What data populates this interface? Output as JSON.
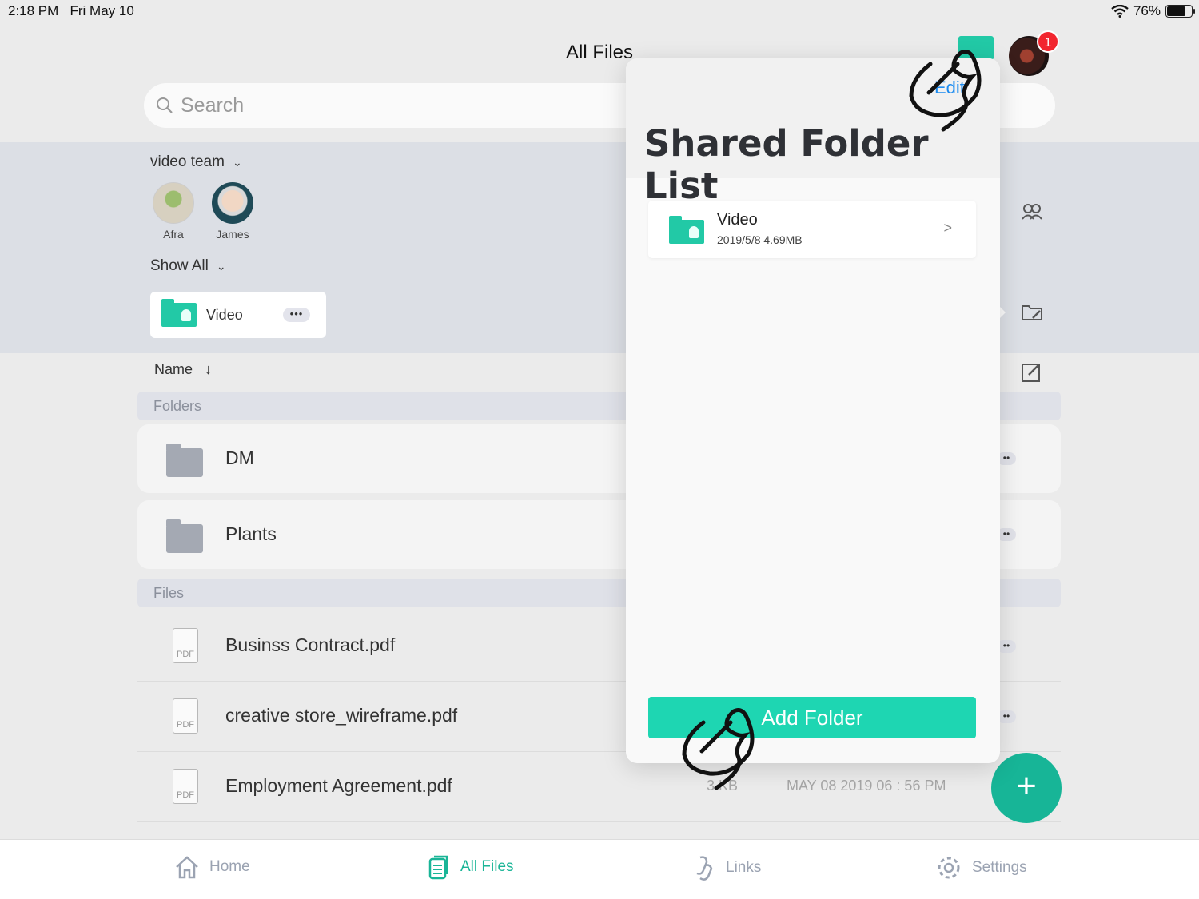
{
  "status_bar": {
    "time": "2:18 PM",
    "date": "Fri May 10",
    "battery": "76%",
    "battery_level": 0.76
  },
  "header": {
    "title": "All Files",
    "notification_count": "1"
  },
  "search": {
    "placeholder": "Search"
  },
  "team": {
    "name": "video team",
    "members": [
      {
        "name": "Afra"
      },
      {
        "name": "James"
      }
    ],
    "filter_label": "Show All",
    "shared_folder": {
      "name": "Video",
      "more": "•••"
    }
  },
  "list": {
    "sort_label": "Name",
    "folders_header": "Folders",
    "folders": [
      {
        "name": "DM"
      },
      {
        "name": "Plants"
      }
    ],
    "files_header": "Files",
    "files": [
      {
        "name": "Businss Contract.pdf",
        "icon": "PDF"
      },
      {
        "name": "creative store_wireframe.pdf",
        "icon": "PDF"
      },
      {
        "name": "Employment Agreement.pdf",
        "icon": "PDF",
        "size": "3 KB",
        "date": "MAY 08 2019 06 : 56 PM"
      }
    ]
  },
  "popover": {
    "edit_label": "Edit",
    "title": "Shared Folder List",
    "items": [
      {
        "name": "Video",
        "meta": "2019/5/8  4.69MB",
        "chevron": ">"
      }
    ],
    "add_button": "Add Folder"
  },
  "tabbar": {
    "tabs": [
      {
        "label": "Home"
      },
      {
        "label": "All Files"
      },
      {
        "label": "Links"
      },
      {
        "label": "Settings"
      }
    ]
  },
  "colors": {
    "accent": "#1ab597",
    "button": "#1ed6b2",
    "badge": "#f2262f",
    "link": "#1d8cf0"
  }
}
